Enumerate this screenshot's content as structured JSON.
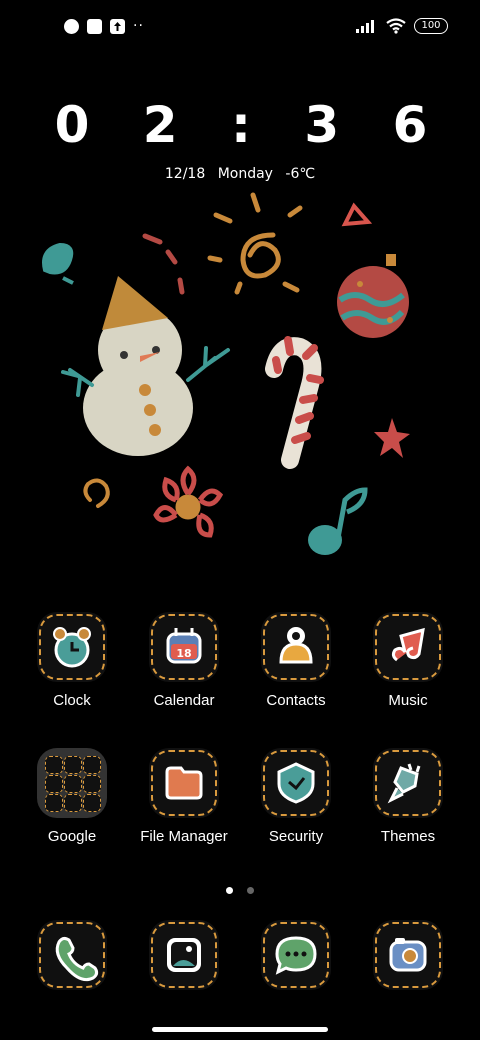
{
  "status_bar": {
    "notification_dots": "··",
    "battery": "100"
  },
  "lockclock": {
    "time": "0 2 : 3 6",
    "date": "12/18",
    "weekday": "Monday",
    "temperature": "-6℃"
  },
  "apps_row1": [
    {
      "label": "Clock",
      "icon": "alarm-clock-icon"
    },
    {
      "label": "Calendar",
      "icon": "calendar-icon",
      "badge": "18"
    },
    {
      "label": "Contacts",
      "icon": "person-icon"
    },
    {
      "label": "Music",
      "icon": "music-note-icon"
    }
  ],
  "apps_row2": [
    {
      "label": "Google",
      "icon": "folder-icon"
    },
    {
      "label": "File Manager",
      "icon": "folder-icon"
    },
    {
      "label": "Security",
      "icon": "shield-icon"
    },
    {
      "label": "Themes",
      "icon": "brush-icon"
    }
  ],
  "dock": [
    {
      "icon": "phone-icon"
    },
    {
      "icon": "gallery-icon"
    },
    {
      "icon": "message-icon"
    },
    {
      "icon": "camera-icon"
    }
  ],
  "page_indicator": {
    "count": 2,
    "active": 0
  },
  "colors": {
    "accent_dash": "#d99a3e",
    "background": "#000000"
  }
}
